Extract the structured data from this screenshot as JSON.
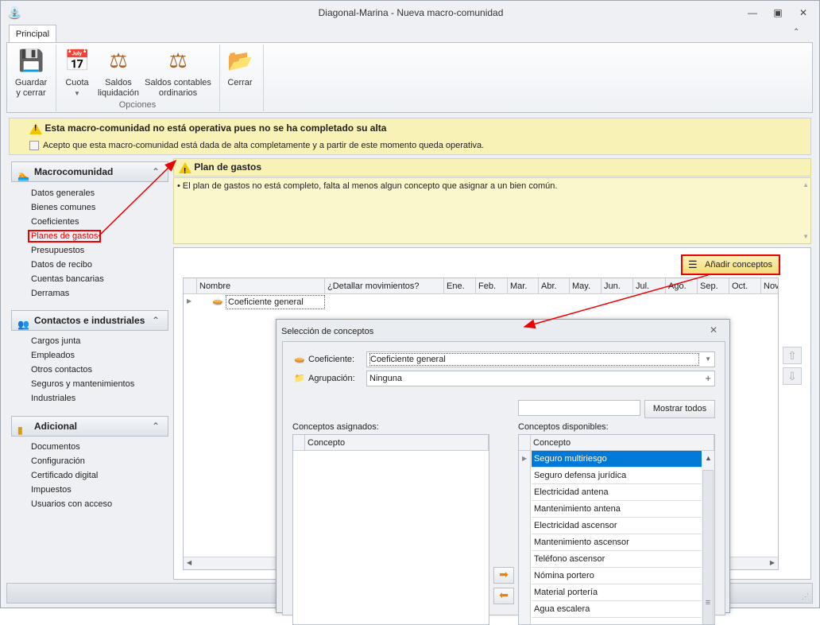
{
  "window": {
    "title": "Diagonal-Marina - Nueva macro-comunidad",
    "controls": [
      "minimize",
      "restore",
      "close"
    ]
  },
  "ribbon": {
    "tab": "Principal",
    "buttons": [
      {
        "label": "Guardar\ny cerrar",
        "icon": "floppy-icon"
      },
      {
        "label": "Cuota",
        "icon": "calendar-coins-icon"
      },
      {
        "label": "Saldos\nliquidación",
        "icon": "scales-icon"
      },
      {
        "label": "Saldos contables\nordinarios",
        "icon": "scales-icon"
      },
      {
        "label": "Cerrar",
        "icon": "folder-exit-icon"
      }
    ],
    "group_label": "Opciones"
  },
  "alert": {
    "message": "Esta macro-comunidad no está operativa pues no se ha completado su alta",
    "checkbox_label": "Acepto que esta macro-comunidad está dada de alta completamente y a partir de este momento queda operativa.",
    "checked": false
  },
  "sidebar": {
    "groups": [
      {
        "title": "Macrocomunidad",
        "items": [
          "Datos generales",
          "Bienes comunes",
          "Coeficientes",
          "Planes de gastos",
          "Presupuestos",
          "Datos de recibo",
          "Cuentas bancarias",
          "Derramas"
        ]
      },
      {
        "title": "Contactos e industriales",
        "items": [
          "Cargos junta",
          "Empleados",
          "Otros contactos",
          "Seguros y mantenimientos",
          "Industriales"
        ]
      },
      {
        "title": "Adicional",
        "items": [
          "Documentos",
          "Configuración",
          "Certificado digital",
          "Impuestos",
          "Usuarios con acceso"
        ]
      }
    ],
    "selected": "Planes de gastos"
  },
  "plan": {
    "title": "Plan de gastos",
    "message": "El plan de gastos no está completo, falta al menos algun concepto que asignar a un bien común."
  },
  "grid": {
    "add_button": "Añadir conceptos",
    "columns": [
      "Nombre",
      "¿Detallar movimientos?",
      "Ene.",
      "Feb.",
      "Mar.",
      "Abr.",
      "May.",
      "Jun.",
      "Jul.",
      "Ago.",
      "Sep.",
      "Oct.",
      "Nov"
    ],
    "rows": [
      {
        "nombre": "Coeficiente general"
      }
    ]
  },
  "dialog": {
    "title": "Selección de conceptos",
    "coef_label": "Coeficiente:",
    "coef_value": "Coeficiente general",
    "agrup_label": "Agrupación:",
    "agrup_value": "Ninguna",
    "search_value": "",
    "show_all": "Mostrar todos",
    "assigned_label": "Conceptos asignados:",
    "available_label": "Conceptos disponibles:",
    "column": "Concepto",
    "available": [
      "Seguro multiriesgo",
      "Seguro defensa jurídica",
      "Electricidad antena",
      "Mantenimiento antena",
      "Electricidad ascensor",
      "Mantenimiento ascensor",
      "Teléfono ascensor",
      "Nómina portero",
      "Material portería",
      "Agua escalera"
    ],
    "selected_available": "Seguro multiriesgo"
  },
  "colors": {
    "accent": "#0078d7",
    "alert_bg": "#f9f2b6",
    "highlight": "#e00000"
  }
}
